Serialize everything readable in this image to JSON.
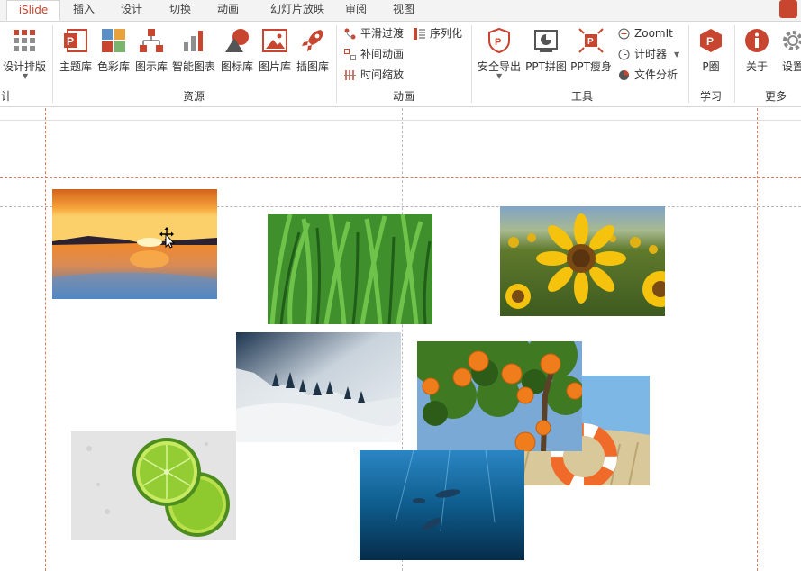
{
  "tabs": [
    {
      "label": "iSlide",
      "active": true
    },
    {
      "label": "插入"
    },
    {
      "label": "设计"
    },
    {
      "label": "切换"
    },
    {
      "label": "动画"
    },
    {
      "label": "幻灯片放映"
    },
    {
      "label": "审阅"
    },
    {
      "label": "视图"
    }
  ],
  "ribbon": {
    "design_layout": "设计排版",
    "resources": [
      "主题库",
      "色彩库",
      "图示库",
      "智能图表",
      "图标库",
      "图片库",
      "插图库"
    ],
    "animation_small": [
      "平滑过渡",
      "补间动画",
      "时间缩放",
      "序列化"
    ],
    "tools_big": [
      "安全导出",
      "PPT拼图",
      "PPT瘦身"
    ],
    "tools_small": [
      "ZoomIt",
      "计时器",
      "文件分析"
    ],
    "learn": "P圈",
    "more": [
      "关于",
      "设置"
    ],
    "groups": {
      "design": "计",
      "resources": "资源",
      "animation": "动画",
      "tools": "工具",
      "learn": "学习",
      "more": "更多"
    }
  },
  "colors": {
    "accent": "#c8452f",
    "guide": "#e07a5f"
  },
  "photos": [
    {
      "name": "sunset-photo",
      "subject": "sunset over water"
    },
    {
      "name": "grass-photo",
      "subject": "green wheat grass"
    },
    {
      "name": "sunflower-photo",
      "subject": "sunflower field"
    },
    {
      "name": "misty-forest-photo",
      "subject": "misty pine forest"
    },
    {
      "name": "orange-tree-photo",
      "subject": "orange tree"
    },
    {
      "name": "lifebuoy-photo",
      "subject": "lifebuoy on beach grass"
    },
    {
      "name": "lime-photo",
      "subject": "lime slices"
    },
    {
      "name": "dolphins-photo",
      "subject": "dolphins underwater"
    }
  ]
}
